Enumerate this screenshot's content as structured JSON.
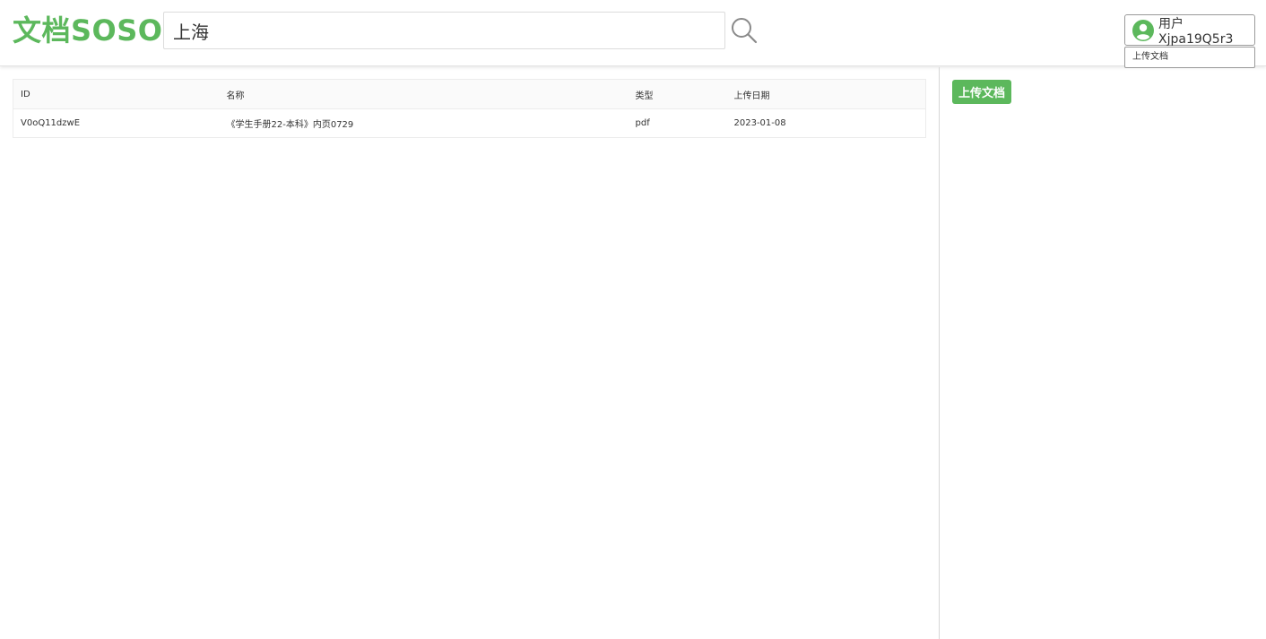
{
  "brand": {
    "logo_text": "文档SOSO",
    "accent_color": "#5cb85c"
  },
  "search": {
    "value": "上海",
    "button_icon": "search-icon"
  },
  "user": {
    "label": "用户 Xjpa19Q5r3",
    "menu_item": "上传文档"
  },
  "table": {
    "headers": [
      "ID",
      "名称",
      "类型",
      "上传日期"
    ],
    "rows": [
      [
        "V0oQ11dzwE",
        "《学生手册22-本科》内页0729",
        "pdf",
        "2023-01-08"
      ]
    ]
  },
  "sidebar": {
    "upload_button": "上传文档"
  }
}
